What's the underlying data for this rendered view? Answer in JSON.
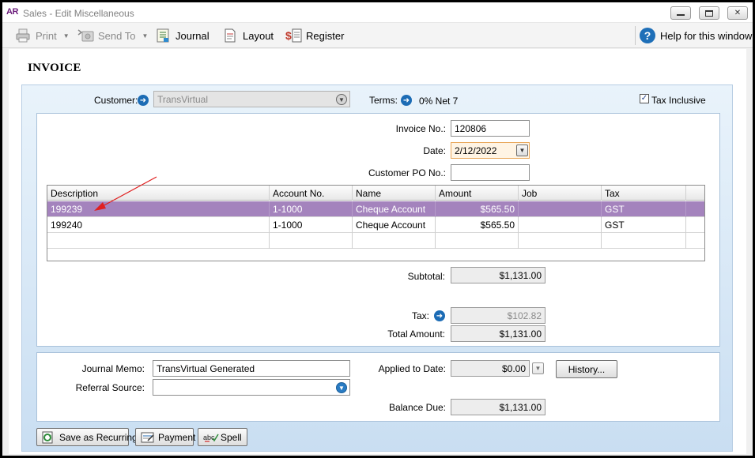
{
  "window": {
    "app_logo": "AR",
    "title": "Sales - Edit Miscellaneous",
    "controls": {
      "minimize": "minimize-icon",
      "maximize": "maximize-icon",
      "close": "close-icon"
    }
  },
  "toolbar": {
    "print": "Print",
    "send_to": "Send To",
    "journal": "Journal",
    "layout": "Layout",
    "register": "Register",
    "help": "Help for this window"
  },
  "page": {
    "title": "INVOICE"
  },
  "header": {
    "customer_label": "Customer:",
    "customer_value": "TransVirtual",
    "terms_label": "Terms:",
    "terms_value": "0% Net 7",
    "tax_inclusive_label": "Tax Inclusive",
    "tax_inclusive_checked": true
  },
  "invoice": {
    "invoice_no_label": "Invoice No.:",
    "invoice_no": "120806",
    "date_label": "Date:",
    "date": "2/12/2022",
    "po_label": "Customer PO No.:",
    "po_value": ""
  },
  "grid": {
    "columns": [
      "Description",
      "Account No.",
      "Name",
      "Amount",
      "Job",
      "Tax"
    ],
    "rows": [
      {
        "description": "199239",
        "account": "1-1000",
        "name": "Cheque Account",
        "amount": "$565.50",
        "job": "",
        "tax": "GST",
        "selected": true
      },
      {
        "description": "199240",
        "account": "1-1000",
        "name": "Cheque Account",
        "amount": "$565.50",
        "job": "",
        "tax": "GST",
        "selected": false
      }
    ]
  },
  "totals": {
    "subtotal_label": "Subtotal:",
    "subtotal": "$1,131.00",
    "tax_label": "Tax:",
    "tax": "$102.82",
    "total_label": "Total Amount:",
    "total": "$1,131.00"
  },
  "footer": {
    "memo_label": "Journal Memo:",
    "memo": "TransVirtual Generated",
    "referral_label": "Referral Source:",
    "referral": "",
    "applied_label": "Applied to Date:",
    "applied": "$0.00",
    "history_button": "History...",
    "balance_label": "Balance Due:",
    "balance": "$1,131.00"
  },
  "actions": {
    "save_recurring": "Save as Recurring",
    "payment": "Payment",
    "spell": "Spell"
  },
  "colors": {
    "selected_row": "#a483bd",
    "panel_gradient_top": "#e9f3fb",
    "panel_gradient_bottom": "#c9def2",
    "accent_blue": "#1c6cb5",
    "annotation_red": "#e02020"
  }
}
